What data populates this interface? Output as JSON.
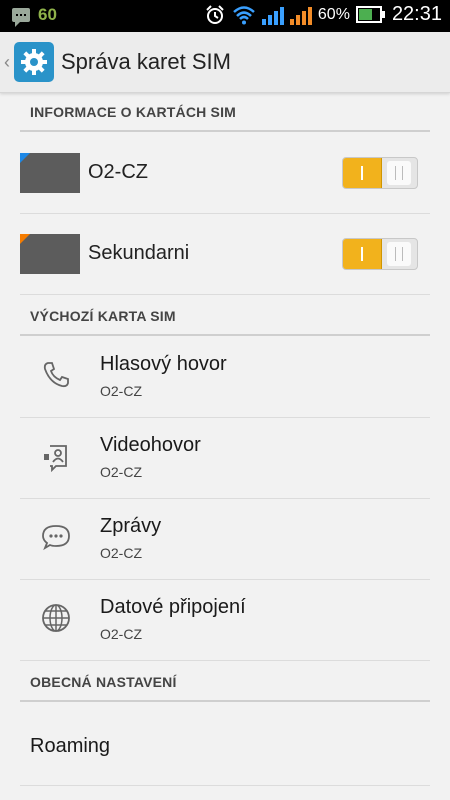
{
  "status_bar": {
    "notification_count": "60",
    "battery_percent": "60%",
    "time": "22:31",
    "icons": [
      "chat-notification-icon",
      "alarm-icon",
      "wifi-icon",
      "signal-sim1-icon",
      "signal-sim2-icon",
      "battery-icon"
    ]
  },
  "action_bar": {
    "title": "Správa karet SIM",
    "icon": "settings-gear-icon"
  },
  "sections": {
    "sim_info": {
      "header": "INFORMACE O KARTÁCH SIM",
      "items": [
        {
          "name": "O2-CZ",
          "corner_color": "#1e88e5",
          "enabled": true
        },
        {
          "name": "Sekundarni",
          "corner_color": "#f57c00",
          "enabled": true
        }
      ]
    },
    "default_sim": {
      "header": "VÝCHOZÍ KARTA SIM",
      "items": [
        {
          "title": "Hlasový hovor",
          "value": "O2-CZ",
          "icon": "phone-icon"
        },
        {
          "title": "Videohovor",
          "value": "O2-CZ",
          "icon": "video-call-icon"
        },
        {
          "title": "Zprávy",
          "value": "O2-CZ",
          "icon": "message-icon"
        },
        {
          "title": "Datové připojení",
          "value": "O2-CZ",
          "icon": "globe-icon"
        }
      ]
    },
    "general": {
      "header": "OBECNÁ NASTAVENÍ",
      "items": [
        {
          "title": "Roaming"
        }
      ]
    }
  },
  "colors": {
    "toggle_on": "#f2b21c",
    "app_icon": "#2a93c9",
    "status_bar_bg": "#000000"
  }
}
